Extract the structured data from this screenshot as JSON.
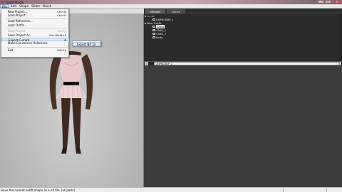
{
  "window": {
    "title": "Outfit Studio",
    "buttons": {
      "minimize": "_",
      "maximize": "□",
      "close": "✕"
    }
  },
  "menubar": [
    "File",
    "Edit",
    "Shape",
    "Slider",
    "Brush"
  ],
  "file_menu": {
    "items": [
      {
        "label": "New Project...",
        "shortcut": "Ctrl+N",
        "enabled": true
      },
      {
        "label": "Load Project...",
        "shortcut": "Ctrl+O",
        "enabled": true
      },
      {
        "label": "Load Reference...",
        "shortcut": "",
        "enabled": true
      },
      {
        "label": "Load Outfit...",
        "shortcut": "",
        "enabled": true
      },
      {
        "label": "Save Project",
        "shortcut": "Ctrl+S",
        "enabled": false
      },
      {
        "label": "Save Project As...",
        "shortcut": "Ctrl+Shift+S",
        "enabled": true
      },
      {
        "label": "Export Current",
        "shortcut": "",
        "enabled": true,
        "submenu": true
      },
      {
        "label": "Make Conversion Reference",
        "shortcut": "",
        "enabled": true
      },
      {
        "label": "Exit",
        "shortcut": "Alt+F4",
        "enabled": true
      }
    ]
  },
  "export_submenu": {
    "item": "Export Nif"
  },
  "panel": {
    "tabs": [
      "Meshes",
      "Bones"
    ],
    "tree": {
      "group1": "<--->",
      "group1_child": "UNPBCBBP_1",
      "group2": "New Outfit",
      "children": [
        "Glass",
        "Cloth_1",
        "Cloth_2",
        "body"
      ]
    },
    "shape_select": "UNPBCBBP_1",
    "shape_icon": "W"
  },
  "status": {
    "text": "Save the current outfit shape as a nif file. (all parts)"
  }
}
